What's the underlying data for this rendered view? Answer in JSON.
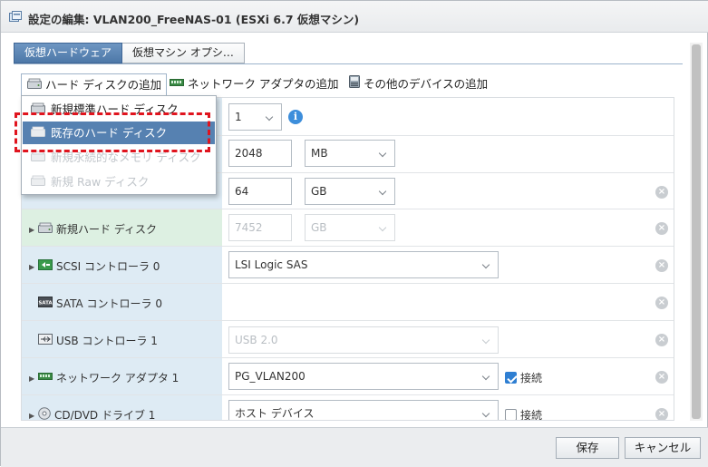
{
  "window": {
    "title": "設定の編集: VLAN200_FreeNAS-01 (ESXi 6.7 仮想マシン)"
  },
  "tabs": [
    {
      "label": "仮想ハードウェア",
      "active": true
    },
    {
      "label": "仮想マシン オプシ…",
      "active": false
    }
  ],
  "add_bar": {
    "add_hard_disk": "ハード ディスクの追加",
    "add_network_adapter": "ネットワーク アダプタの追加",
    "add_other_device": "その他のデバイスの追加"
  },
  "dropdown_menu": {
    "items": [
      {
        "label": "新規標準ハード ディスク",
        "state": "normal"
      },
      {
        "label": "既存のハード ディスク",
        "state": "selected"
      },
      {
        "label": "新規永続的なメモリ ディスク",
        "state": "disabled"
      },
      {
        "label": "新規 Raw ディスク",
        "state": "disabled"
      }
    ]
  },
  "rows": {
    "cpu": {
      "value": "1"
    },
    "memory": {
      "value": "2048",
      "unit": "MB"
    },
    "hard_disk_1": {
      "value": "64",
      "unit": "GB"
    },
    "new_hard_disk": {
      "label": "新規ハード ディスク",
      "value": "7452",
      "unit": "GB"
    },
    "scsi": {
      "label": "SCSI コントローラ 0",
      "value": "LSI Logic SAS"
    },
    "sata": {
      "label": "SATA コントローラ 0"
    },
    "usb": {
      "label": "USB コントローラ 1",
      "value": "USB 2.0"
    },
    "network": {
      "label": "ネットワーク アダプタ 1",
      "value": "PG_VLAN200",
      "connect": "接続",
      "connected": true
    },
    "cdrom": {
      "label": "CD/DVD ドライブ 1",
      "value": "ホスト デバイス",
      "connect": "接続",
      "connected": false
    }
  },
  "footer": {
    "save": "保存",
    "cancel": "キャンセル"
  },
  "colors": {
    "accent": "#5681b1",
    "highlight": "#e0141e",
    "info": "#3d8edb"
  },
  "icons": [
    "settings-window-icon",
    "hard-disk-icon",
    "network-adapter-icon",
    "other-device-icon",
    "scsi-icon",
    "sata-icon",
    "usb-icon",
    "cd-dvd-icon",
    "info-icon",
    "remove-icon",
    "chevron-down-icon"
  ]
}
